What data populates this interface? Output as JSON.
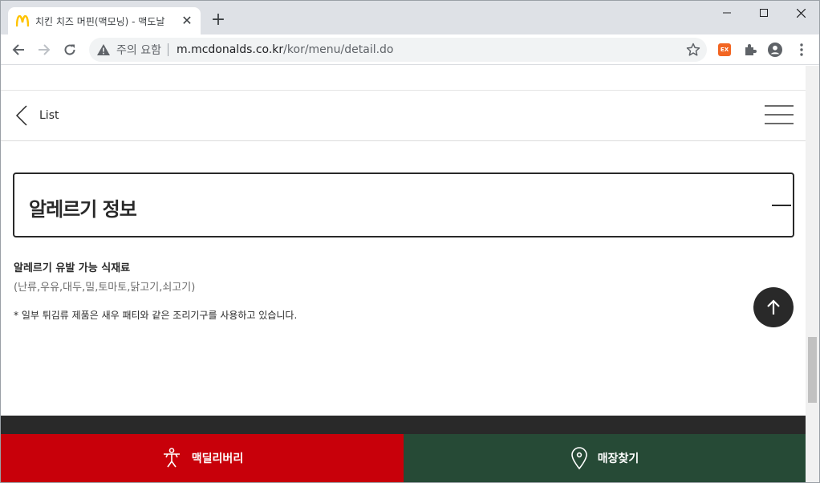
{
  "browser": {
    "tab": {
      "title": "치킨 치즈 머핀(맥모닝) - 맥도날",
      "close_glyph": "✕"
    },
    "new_tab_glyph": "+",
    "omnibox": {
      "security_text": "주의 요함",
      "host": "m.mcdonalds.co.kr",
      "path": "/kor/menu/detail.do"
    },
    "extension_badge": "EX"
  },
  "page": {
    "back_label": "List",
    "section_title": "알레르기 정보",
    "allergy_heading": "알레르기 유발 가능 식재료",
    "allergy_list": "(난류,우유,대두,밀,토마토,닭고기,쇠고기)",
    "allergy_note": "* 일부 튀김류 제품은 새우 패티와 같은 조리기구를 사용하고 있습니다.",
    "bottom_bar": {
      "delivery_label": "맥딜리버리",
      "store_label": "매장찾기"
    }
  },
  "colors": {
    "mcdonalds_yellow": "#ffc300",
    "delivery_red": "#c8000a",
    "store_green": "#264a36",
    "dark": "#292929"
  }
}
